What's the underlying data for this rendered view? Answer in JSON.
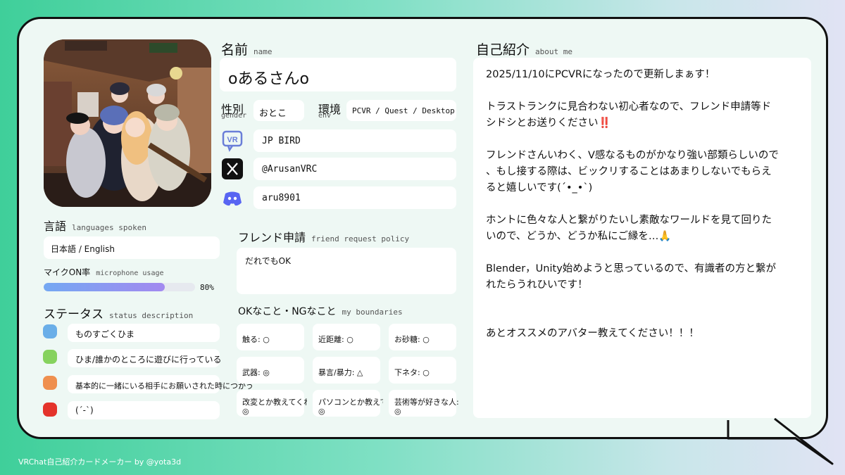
{
  "name": {
    "heading": "名前",
    "sub": "name",
    "value": "oあるさんo"
  },
  "gender": {
    "heading": "性別",
    "sub": "gender",
    "value": "おとこ"
  },
  "env": {
    "heading": "環境",
    "sub": "env",
    "value": "PCVR / Quest / Desktop"
  },
  "socials": {
    "vrchat": "JP BIRD",
    "x": "@ArusanVRC",
    "discord": "aru8901"
  },
  "languages": {
    "heading": "言語",
    "sub": "languages spoken",
    "value": "日本語 / English"
  },
  "mic": {
    "heading": "マイクON率",
    "sub": "microphone usage",
    "value": "80%",
    "fraction": 0.8
  },
  "status": {
    "heading": "ステータス",
    "sub": "status description",
    "items": [
      {
        "color": "#6aaee8",
        "text": "ものすごくひま"
      },
      {
        "color": "#86d25e",
        "text": "ひま/誰かのところに遊びに行っている"
      },
      {
        "color": "#ef8f4e",
        "text": "基本的に一緒にいる相手にお願いされた時につかう"
      },
      {
        "color": "#e4332b",
        "text": "(´-`)"
      }
    ]
  },
  "friend": {
    "heading": "フレンド申請",
    "sub": "friend request policy",
    "value": "だれでもOK"
  },
  "boundaries": {
    "heading": "OKなこと・NGなこと",
    "sub": "my boundaries",
    "items": [
      "触る: ○",
      "近距離: ○",
      "お砂糖: ○",
      "武器: ◎",
      "暴言/暴力: △",
      "下ネタ: ○",
      "改変とか教えてくれ",
      "パソコンとか教えて",
      "芸術等が好きな人:"
    ],
    "marks": [
      "◎",
      "◎",
      "◎"
    ]
  },
  "about": {
    "heading": "自己紹介",
    "sub": "about me",
    "paragraphs": [
      "2025/11/10にPCVRになったので更新しまぁす！",
      "トラストランクに見合わない初心者なので、フレンド申請等ド\nシドシとお送りください‼️",
      "フレンドさんいわく、V感なるものがかなり強い部類らしいので\n、もし接する際は、ビックリすることはあまりしないでもらえ\nると嬉しいです(´•_•`)",
      "ホントに色々な人と繋がりたいし素敵なワールドを見て回りた\nいので、どうか、どうか私にご縁を…🙏",
      "Blender，Unity始めようと思っているので、有識者の方と繋が\nれたらうれひいです！",
      "\nあとオススメのアバター教えてください！！！"
    ]
  },
  "footer": "VRChat自己紹介カードメーカー by @yota3d",
  "icons": {
    "vrchat": "vrchat-icon",
    "x": "x-logo-icon",
    "discord": "discord-icon",
    "avatar": "avatar-photo"
  }
}
